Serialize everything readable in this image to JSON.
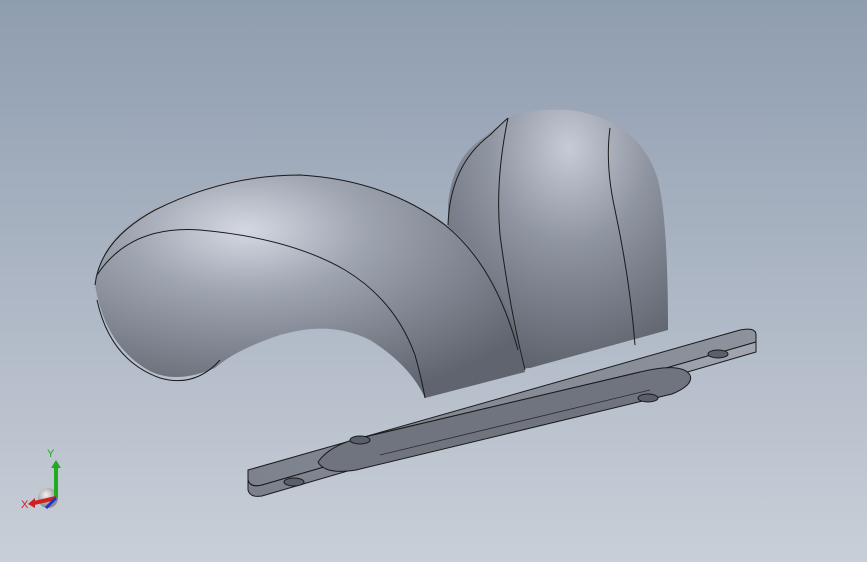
{
  "viewport": {
    "background_top_color": "#8f9db0",
    "background_bottom_color": "#c9cfd8"
  },
  "model": {
    "body_color": "#8c929d",
    "highlight_color": "#c6cbd6",
    "shadow_color": "#5f646e",
    "edge_color": "#1a1a1a"
  },
  "triad": {
    "x_label": "X",
    "y_label": "Y",
    "x_color": "#cc2222",
    "y_color": "#22aa22",
    "z_color": "#2233cc"
  }
}
